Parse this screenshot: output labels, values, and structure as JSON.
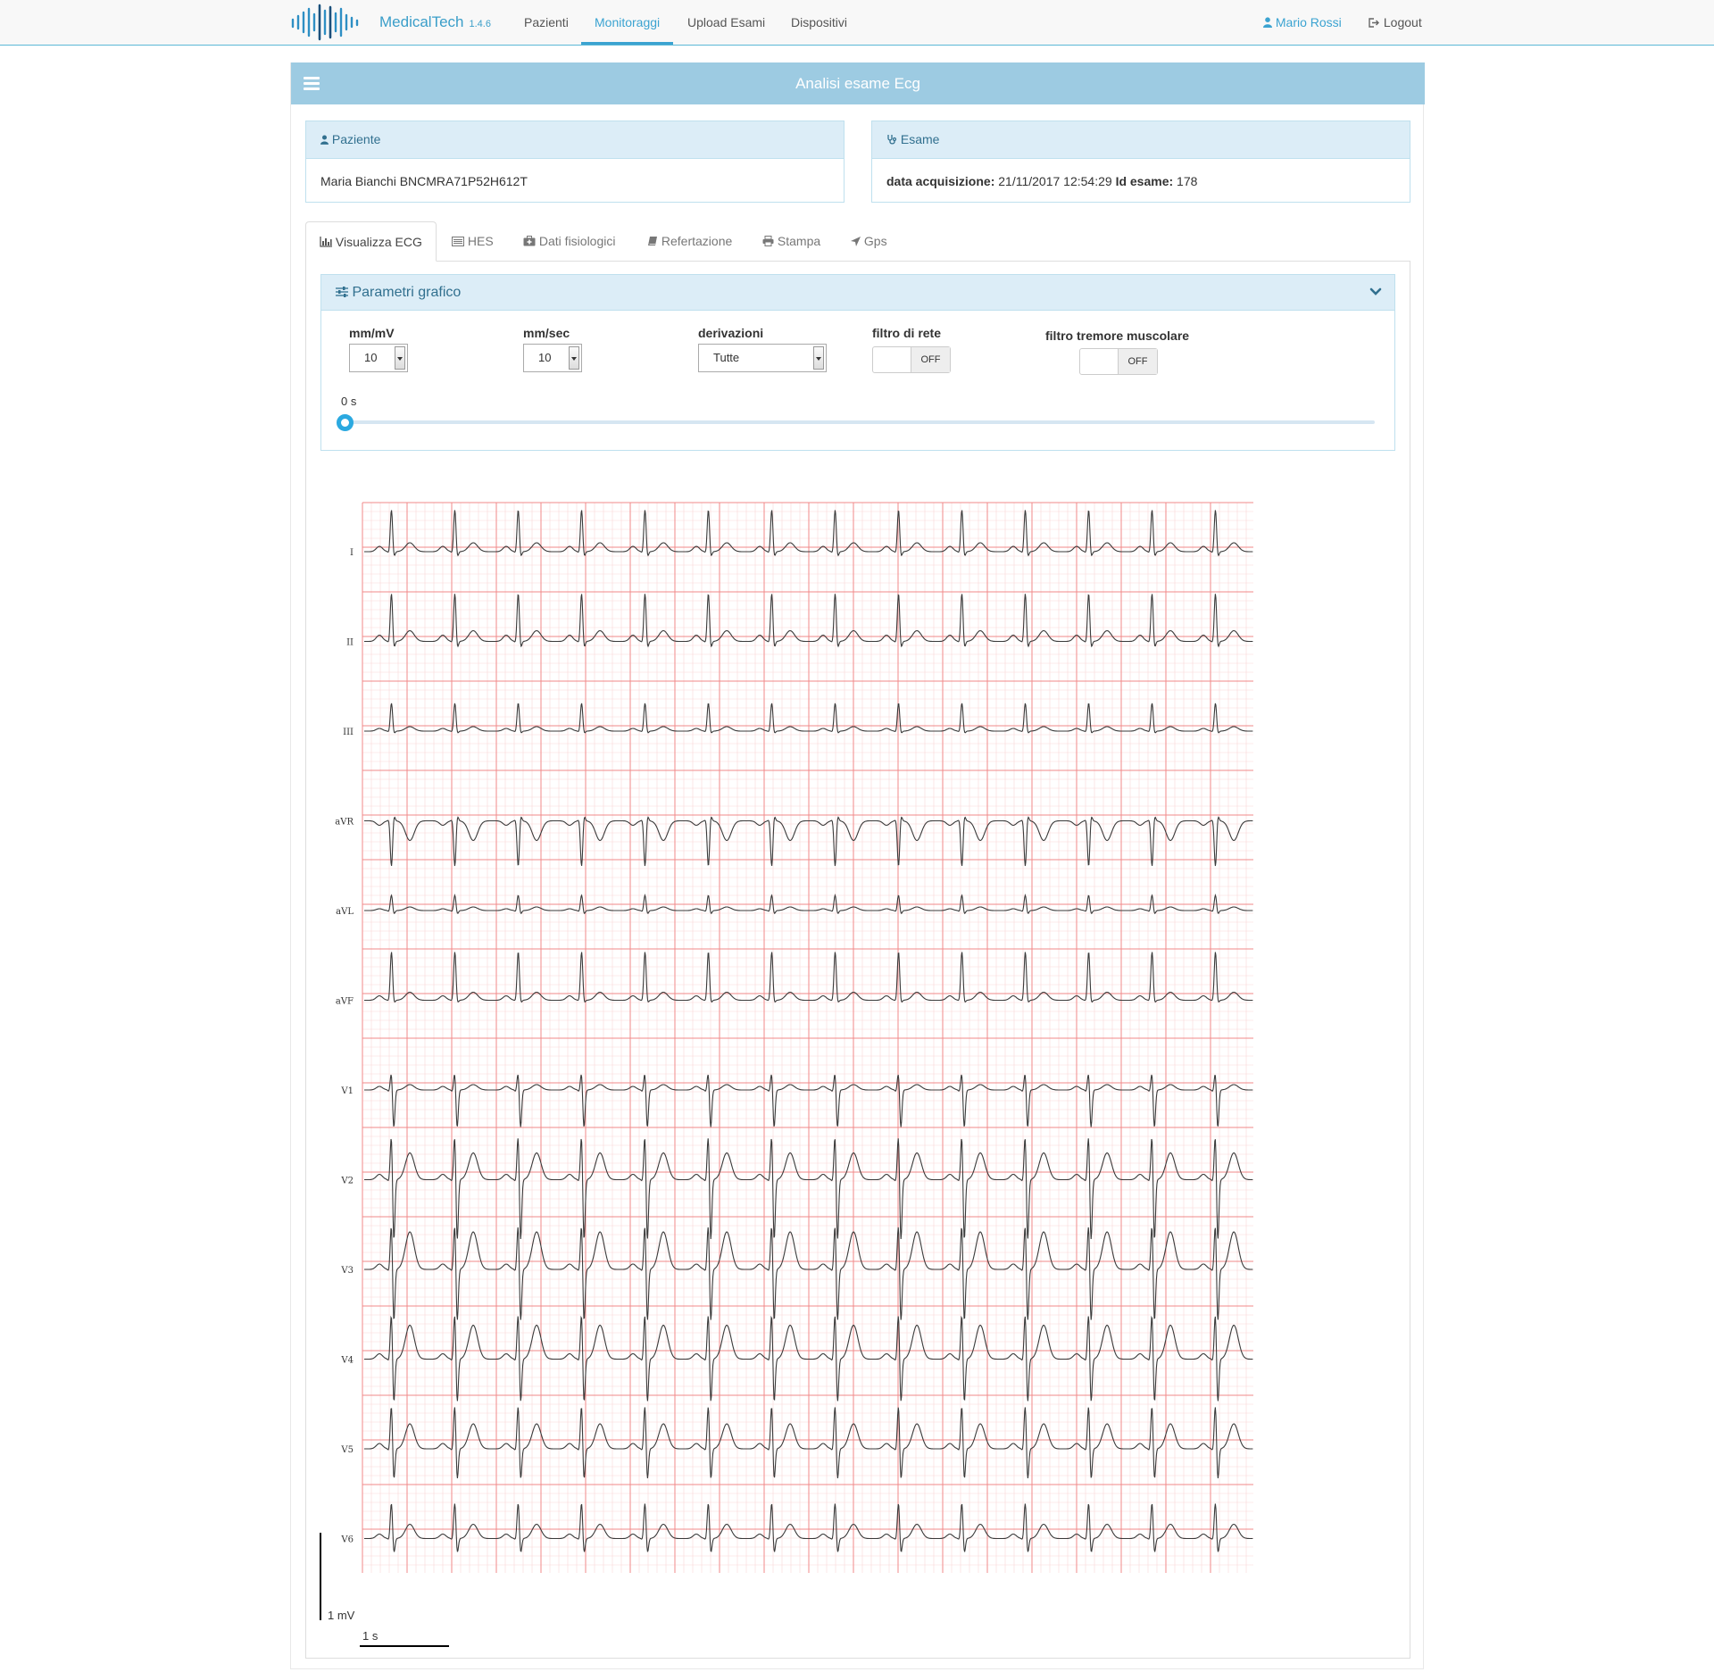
{
  "app": {
    "name": "MedicalTech",
    "version": "1.4.6"
  },
  "nav": {
    "items": [
      {
        "label": "Pazienti",
        "active": false
      },
      {
        "label": "Monitoraggi",
        "active": true
      },
      {
        "label": "Upload Esami",
        "active": false
      },
      {
        "label": "Dispositivi",
        "active": false
      }
    ],
    "user": "Mario Rossi",
    "logout": "Logout"
  },
  "page": {
    "title": "Analisi esame Ecg"
  },
  "patient": {
    "heading": "Paziente",
    "name": "Maria Bianchi BNCMRA71P52H612T"
  },
  "exam": {
    "heading": "Esame",
    "acq_label": "data acquisizione:",
    "acq_value": "21/11/2017 12:54:29",
    "id_label": "Id esame:",
    "id_value": "178"
  },
  "tabs": [
    {
      "label": "Visualizza ECG",
      "icon": "bar-chart-icon",
      "active": true
    },
    {
      "label": "HES",
      "icon": "list-icon",
      "active": false
    },
    {
      "label": "Dati fisiologici",
      "icon": "medkit-icon",
      "active": false
    },
    {
      "label": "Refertazione",
      "icon": "book-icon",
      "active": false
    },
    {
      "label": "Stampa",
      "icon": "print-icon",
      "active": false
    },
    {
      "label": "Gps",
      "icon": "location-arrow-icon",
      "active": false
    }
  ],
  "params": {
    "heading": "Parametri grafico",
    "mm_mv": {
      "label": "mm/mV",
      "value": "10"
    },
    "mm_sec": {
      "label": "mm/sec",
      "value": "10"
    },
    "derivazioni": {
      "label": "derivazioni",
      "value": "Tutte"
    },
    "filtro_rete": {
      "label": "filtro di rete",
      "value": "OFF"
    },
    "filtro_tremore": {
      "label": "filtro tremore muscolare",
      "value": "OFF"
    },
    "slider": {
      "value": "0 s",
      "fraction": 0
    }
  },
  "ecg": {
    "leads": [
      "I",
      "II",
      "III",
      "aVR",
      "aVL",
      "aVF",
      "V1",
      "V2",
      "V3",
      "V4",
      "V5",
      "V6"
    ],
    "amplitude_label": "1 mV",
    "time_label": "1 s",
    "beats": 14,
    "colors": {
      "major_grid": "#f08a8a",
      "minor_grid": "#f9d7d7",
      "trace": "#3a3a3a"
    }
  },
  "colors": {
    "accent": "#3ba3d1",
    "header_bar": "#9dcbe2",
    "panel_head": "#dcedf7"
  }
}
